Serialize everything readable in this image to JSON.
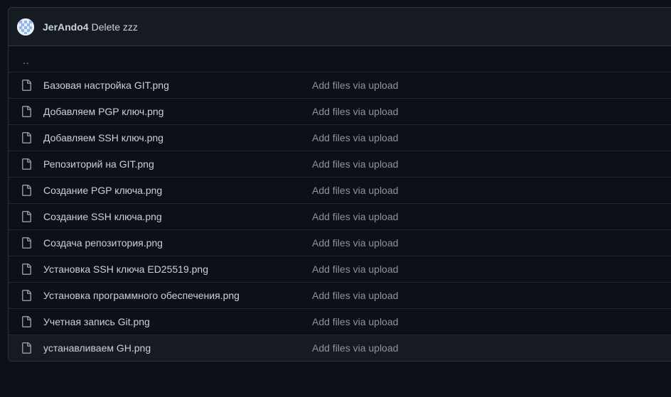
{
  "header": {
    "author": "JerAndo4",
    "message": "Delete zzz"
  },
  "parent_link": "..",
  "files": [
    {
      "name": "Базовая настройка GIT.png",
      "commit": "Add files via upload"
    },
    {
      "name": "Добавляем PGP ключ.png",
      "commit": "Add files via upload"
    },
    {
      "name": "Добавляем SSH ключ.png",
      "commit": "Add files via upload"
    },
    {
      "name": "Репозиторий на GIT.png",
      "commit": "Add files via upload"
    },
    {
      "name": "Создание PGP ключа.png",
      "commit": "Add files via upload"
    },
    {
      "name": "Создание SSH ключа.png",
      "commit": "Add files via upload"
    },
    {
      "name": "Создача репозитория.png",
      "commit": "Add files via upload"
    },
    {
      "name": "Установка SSH ключа ED25519.png",
      "commit": "Add files via upload"
    },
    {
      "name": "Установка программного обеспечения.png",
      "commit": "Add files via upload"
    },
    {
      "name": "Учетная запись Git.png",
      "commit": "Add files via upload"
    },
    {
      "name": "устанавливаем GH.png",
      "commit": "Add files via upload"
    }
  ],
  "colors": {
    "background": "#0d1117",
    "header_bg": "#161b22",
    "border": "#30363d",
    "link": "#58a6ff",
    "muted": "#8b949e"
  }
}
